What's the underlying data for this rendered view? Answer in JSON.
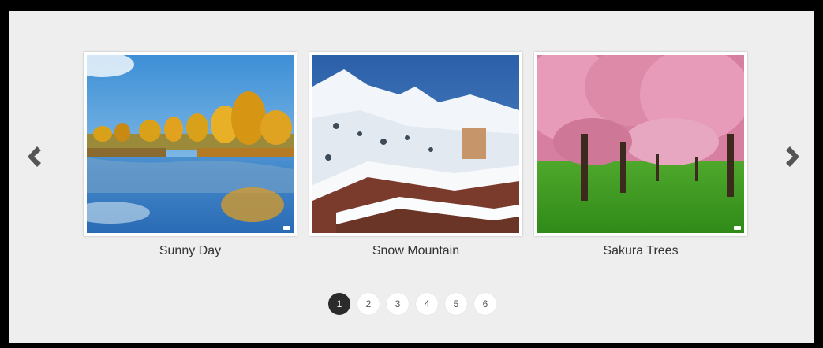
{
  "carousel": {
    "prev_icon": "chevron-left-icon",
    "next_icon": "chevron-right-icon",
    "slides": [
      {
        "caption": "Sunny Day",
        "image": "autumn lake landscape"
      },
      {
        "caption": "Snow Mountain",
        "image": "snowy mountain village"
      },
      {
        "caption": "Sakura Trees",
        "image": "pink cherry blossom trees"
      }
    ],
    "pages": [
      "1",
      "2",
      "3",
      "4",
      "5",
      "6"
    ],
    "active_page": 1
  },
  "colors": {
    "background": "#eeeeee",
    "active_dot": "#2b2b2b",
    "arrow": "#555555"
  }
}
